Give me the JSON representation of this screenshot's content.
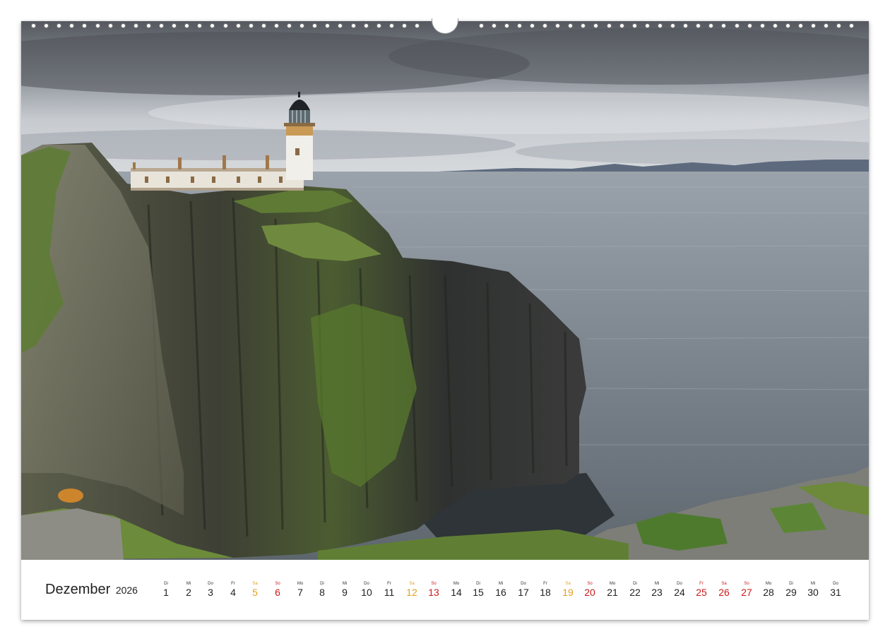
{
  "calendar": {
    "month": "Dezember",
    "year": "2026",
    "days": [
      {
        "num": "1",
        "wd": "Di",
        "type": "weekday"
      },
      {
        "num": "2",
        "wd": "Mi",
        "type": "weekday"
      },
      {
        "num": "3",
        "wd": "Do",
        "type": "weekday"
      },
      {
        "num": "4",
        "wd": "Fr",
        "type": "weekday"
      },
      {
        "num": "5",
        "wd": "Sa",
        "type": "sat"
      },
      {
        "num": "6",
        "wd": "So",
        "type": "sun"
      },
      {
        "num": "7",
        "wd": "Mo",
        "type": "weekday"
      },
      {
        "num": "8",
        "wd": "Di",
        "type": "weekday"
      },
      {
        "num": "9",
        "wd": "Mi",
        "type": "weekday"
      },
      {
        "num": "10",
        "wd": "Do",
        "type": "weekday"
      },
      {
        "num": "11",
        "wd": "Fr",
        "type": "weekday"
      },
      {
        "num": "12",
        "wd": "Sa",
        "type": "sat"
      },
      {
        "num": "13",
        "wd": "So",
        "type": "sun"
      },
      {
        "num": "14",
        "wd": "Mo",
        "type": "weekday"
      },
      {
        "num": "15",
        "wd": "Di",
        "type": "weekday"
      },
      {
        "num": "16",
        "wd": "Mi",
        "type": "weekday"
      },
      {
        "num": "17",
        "wd": "Do",
        "type": "weekday"
      },
      {
        "num": "18",
        "wd": "Fr",
        "type": "weekday"
      },
      {
        "num": "19",
        "wd": "Sa",
        "type": "sat"
      },
      {
        "num": "20",
        "wd": "So",
        "type": "sun"
      },
      {
        "num": "21",
        "wd": "Mo",
        "type": "weekday"
      },
      {
        "num": "22",
        "wd": "Di",
        "type": "weekday"
      },
      {
        "num": "23",
        "wd": "Mi",
        "type": "weekday"
      },
      {
        "num": "24",
        "wd": "Do",
        "type": "weekday"
      },
      {
        "num": "25",
        "wd": "Fr",
        "type": "hol"
      },
      {
        "num": "26",
        "wd": "Sa",
        "type": "hol"
      },
      {
        "num": "27",
        "wd": "So",
        "type": "sun"
      },
      {
        "num": "28",
        "wd": "Mo",
        "type": "weekday"
      },
      {
        "num": "29",
        "wd": "Di",
        "type": "weekday"
      },
      {
        "num": "30",
        "wd": "Mi",
        "type": "weekday"
      },
      {
        "num": "31",
        "wd": "Do",
        "type": "weekday"
      }
    ]
  },
  "colors": {
    "saturday": "#e0a020",
    "sunday_holiday": "#cc1a1a",
    "text": "#222222"
  }
}
